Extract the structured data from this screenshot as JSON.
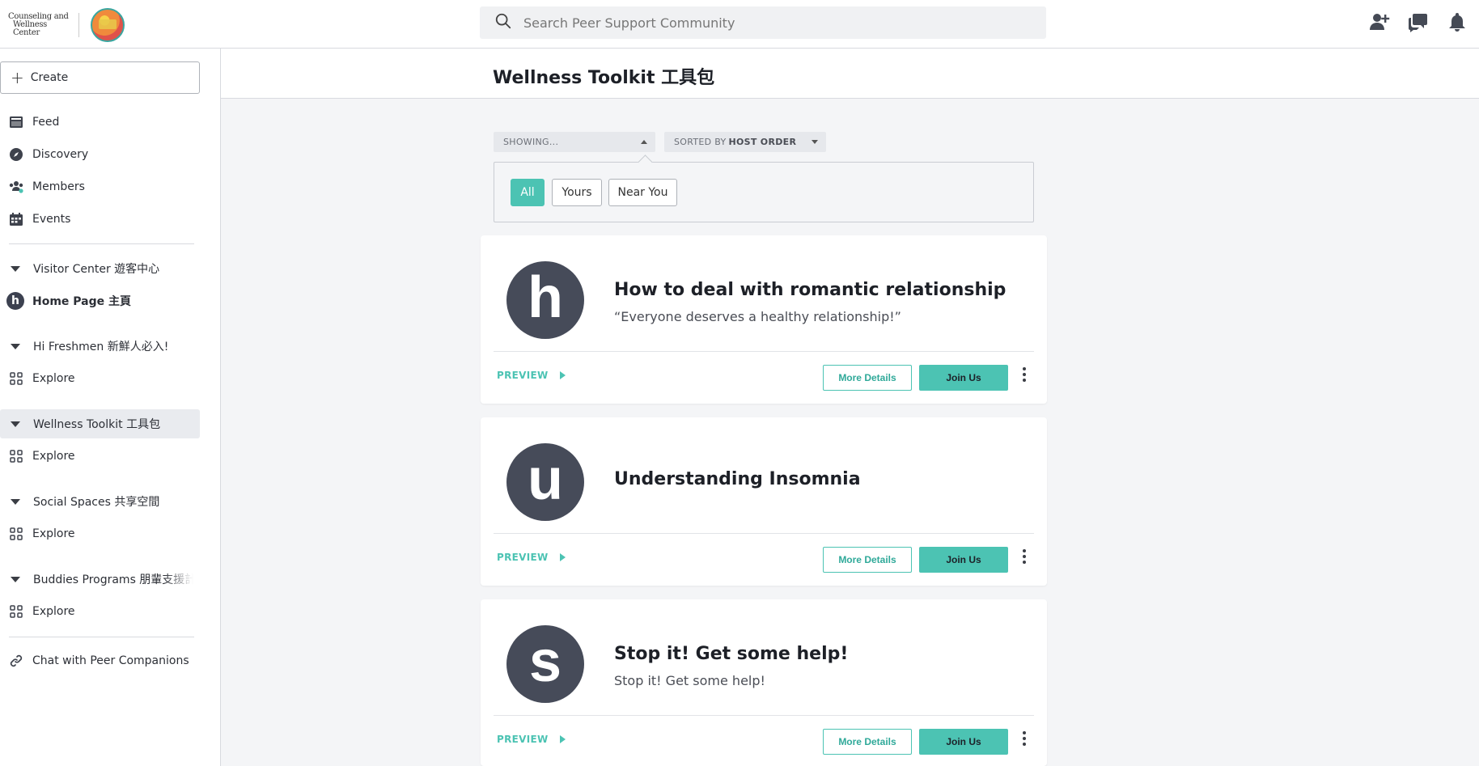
{
  "brand": {
    "line1": "Counseling and",
    "line2": "Wellness Center",
    "logo_icon": "peer-support-community-logo"
  },
  "search": {
    "placeholder": "Search Peer Support Community"
  },
  "top_icons": [
    "add-person-icon",
    "chat-icon",
    "bell-icon"
  ],
  "sidebar": {
    "create_label": "Create",
    "main_nav": [
      {
        "label": "Feed",
        "icon": "feed-icon"
      },
      {
        "label": "Discovery",
        "icon": "compass-icon"
      },
      {
        "label": "Members",
        "icon": "members-icon"
      },
      {
        "label": "Events",
        "icon": "calendar-icon"
      }
    ],
    "groups": [
      {
        "title": "Visitor Center 遊客中心",
        "child": "Home Page 主頁",
        "child_avatar": "h"
      },
      {
        "title": "Hi Freshmen 新鮮人必入!",
        "child": "Explore"
      },
      {
        "title": "Wellness Toolkit 工具包",
        "child": "Explore"
      },
      {
        "title": "Social Spaces 共享空間",
        "child": "Explore"
      },
      {
        "title": "Buddies Programs 朋輩支援計劃",
        "child": "Explore"
      }
    ],
    "link": "Chat with Peer Companions"
  },
  "page": {
    "title": "Wellness Toolkit 工具包"
  },
  "filters": {
    "showing_label": "SHOWING...",
    "sorted_prefix": "SORTED BY",
    "sorted_value": "HOST ORDER",
    "chips": [
      "All",
      "Yours",
      "Near You"
    ],
    "selected_chip": "All"
  },
  "cards": [
    {
      "avatar": "h",
      "title": "How to deal with romantic relationship",
      "subtitle": "“Everyone deserves a healthy relationship!”",
      "preview": "PREVIEW",
      "details": "More Details",
      "join": "Join Us"
    },
    {
      "avatar": "u",
      "title": "Understanding Insomnia",
      "subtitle": "",
      "preview": "PREVIEW",
      "details": "More Details",
      "join": "Join Us"
    },
    {
      "avatar": "s",
      "title": "Stop it! Get some help!",
      "subtitle": "Stop it! Get some help!",
      "preview": "PREVIEW",
      "details": "More Details",
      "join": "Join Us"
    }
  ],
  "colors": {
    "accent": "#4cc3b3",
    "avatar_bg": "#464b59",
    "page_bg": "#f4f5f7"
  }
}
